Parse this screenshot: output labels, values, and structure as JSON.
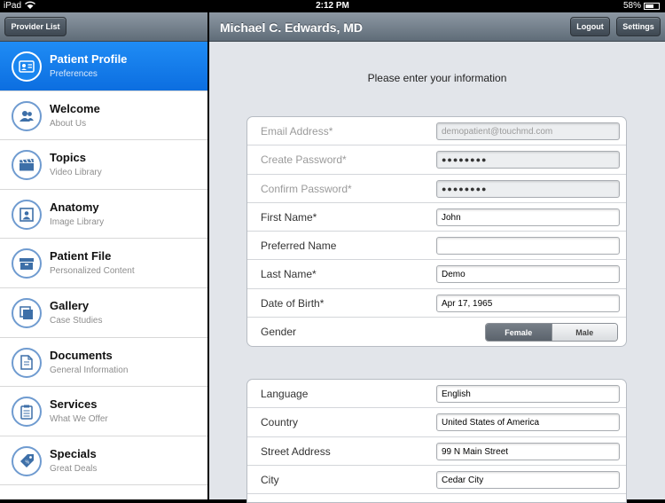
{
  "status": {
    "device": "iPad",
    "time": "2:12 PM",
    "battery": "58%"
  },
  "sidebar": {
    "provider_list_label": "Provider List",
    "items": [
      {
        "title": "Patient Profile",
        "subtitle": "Preferences",
        "icon": "id-card-icon",
        "active": true
      },
      {
        "title": "Welcome",
        "subtitle": "About Us",
        "icon": "people-icon",
        "active": false
      },
      {
        "title": "Topics",
        "subtitle": "Video Library",
        "icon": "clapperboard-icon",
        "active": false
      },
      {
        "title": "Anatomy",
        "subtitle": "Image Library",
        "icon": "picture-icon",
        "active": false
      },
      {
        "title": "Patient File",
        "subtitle": "Personalized Content",
        "icon": "file-box-icon",
        "active": false
      },
      {
        "title": "Gallery",
        "subtitle": "Case Studies",
        "icon": "gallery-icon",
        "active": false
      },
      {
        "title": "Documents",
        "subtitle": "General Information",
        "icon": "document-icon",
        "active": false
      },
      {
        "title": "Services",
        "subtitle": "What We Offer",
        "icon": "clipboard-icon",
        "active": false
      },
      {
        "title": "Specials",
        "subtitle": "Great Deals",
        "icon": "price-tag-icon",
        "active": false
      }
    ]
  },
  "header": {
    "title": "Michael C. Edwards, MD",
    "logout_label": "Logout",
    "settings_label": "Settings"
  },
  "form": {
    "prompt": "Please enter your information",
    "email": {
      "label": "Email Address*",
      "value": "demopatient@touchmd.com"
    },
    "create_password": {
      "label": "Create Password*",
      "value": "●●●●●●●●"
    },
    "confirm_password": {
      "label": "Confirm Password*",
      "value": "●●●●●●●●"
    },
    "first_name": {
      "label": "First Name*",
      "value": "John"
    },
    "preferred_name": {
      "label": "Preferred Name",
      "value": ""
    },
    "last_name": {
      "label": "Last Name*",
      "value": "Demo"
    },
    "dob": {
      "label": "Date of Birth*",
      "value": "Apr 17, 1965"
    },
    "gender": {
      "label": "Gender",
      "options": [
        "Female",
        "Male"
      ],
      "selected": "Female"
    },
    "language": {
      "label": "Language",
      "value": "English"
    },
    "country": {
      "label": "Country",
      "value": "United States of America"
    },
    "street": {
      "label": "Street Address",
      "value": "99 N Main Street"
    },
    "city": {
      "label": "City",
      "value": "Cedar City"
    }
  },
  "colors": {
    "accent": "#0c6ee0",
    "toolbar": "#6d7985"
  }
}
